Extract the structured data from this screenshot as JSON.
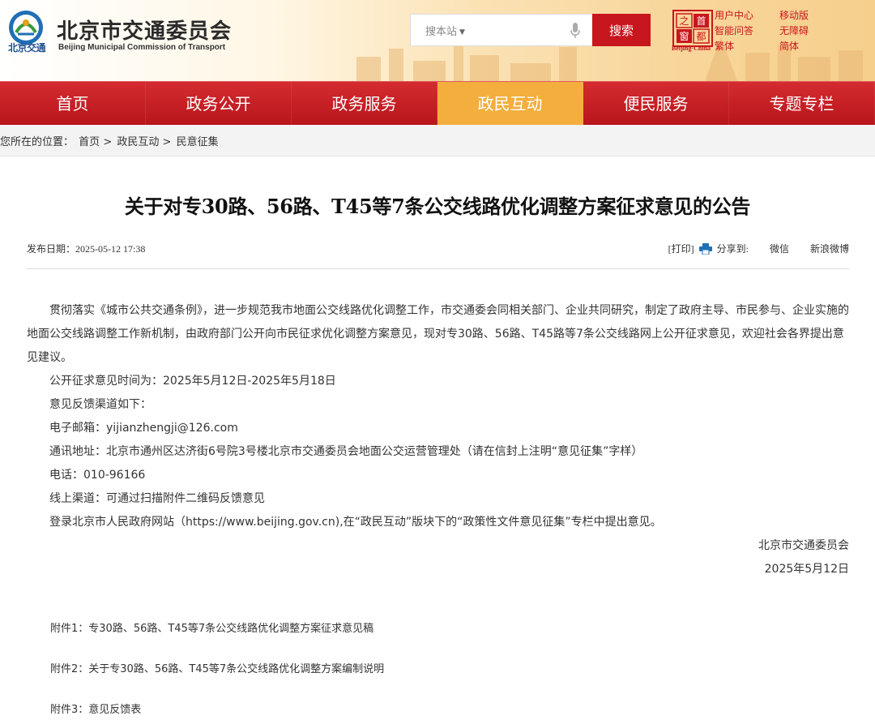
{
  "header": {
    "site_name": "北京市交通委员会",
    "site_name_en": "Beijing Municipal Commission of Transport",
    "logo_sub": "北京交通",
    "search": {
      "scope": "搜本站",
      "placeholder": "",
      "button_label": "搜索"
    },
    "capital_logo_en": "Beijing·China",
    "links_col1": [
      "用户中心",
      "智能问答",
      "繁体"
    ],
    "links_col2": [
      "移动版",
      "无障碍",
      "简体"
    ]
  },
  "nav": {
    "items": [
      {
        "label": "首页"
      },
      {
        "label": "政务公开"
      },
      {
        "label": "政务服务"
      },
      {
        "label": "政民互动",
        "active": true
      },
      {
        "label": "便民服务"
      },
      {
        "label": "专题专栏"
      }
    ]
  },
  "breadcrumb": {
    "prefix": "您所在的位置：",
    "items": [
      "首页",
      "政民互动",
      "民意征集"
    ],
    "separator": ">"
  },
  "article": {
    "title": "关于对专30路、56路、T45等7条公交线路优化调整方案征求意见的公告",
    "date_label": "发布日期：",
    "date": "2025-05-12 17:38",
    "print_label": "[打印]",
    "share_label": "分享到:",
    "share_wechat": "微信",
    "share_weibo": "新浪微博",
    "paragraph1": "贯彻落实《城市公共交通条例》，进一步规范我市地面公交线路优化调整工作，市交通委会同相关部门、企业共同研究，制定了政府主导、市民参与、企业实施的地面公交线路调整工作新机制，由政府部门公开向市民征求优化调整方案意见，现对专30路、56路、T45路等7条公交线路网上公开征求意见，欢迎社会各界提出意见建议。",
    "lines": [
      "公开征求意见时间为：2025年5月12日-2025年5月18日",
      "意见反馈渠道如下：",
      "电子邮箱：yijianzhengji@126.com",
      "通讯地址：北京市通州区达济街6号院3号楼北京市交通委员会地面公交运营管理处（请在信封上注明“意见征集”字样）",
      "电话：010-96166",
      "线上渠道：可通过扫描附件二维码反馈意见",
      "登录北京市人民政府网站（https://www.beijing.gov.cn),在“政民互动”版块下的“政策性文件意见征集”专栏中提出意见。"
    ],
    "signature_org": "北京市交通委员会",
    "signature_date": "2025年5月12日",
    "attachments": [
      "附件1：专30路、56路、T45等7条公交线路优化调整方案征求意见稿",
      "附件2：关于专30路、56路、T45等7条公交线路优化调整方案编制说明",
      "附件3：意见反馈表"
    ]
  },
  "colors": {
    "brand_red": "#c8161e",
    "nav_active": "#f4ae3d"
  }
}
